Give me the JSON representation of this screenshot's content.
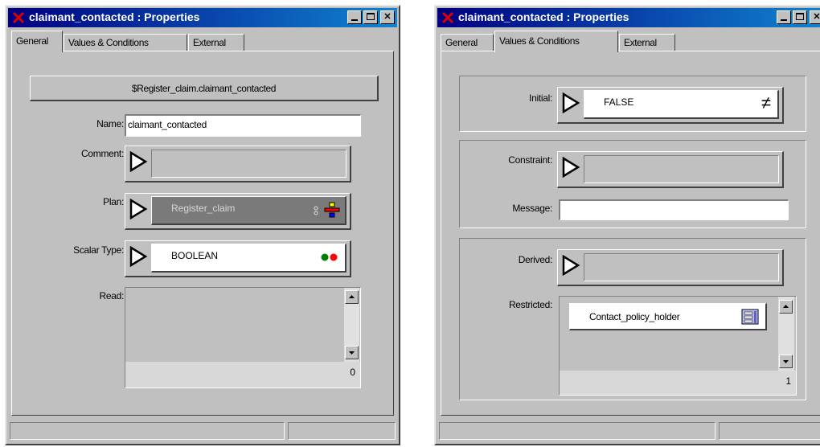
{
  "left_window": {
    "title": "claimant_contacted : Properties",
    "tabs": [
      "General",
      "Values & Conditions",
      "External"
    ],
    "active_tab": "General",
    "path_header": "$Register_claim.claimant_contacted",
    "name_label": "Name:",
    "name_value": "claimant_contacted",
    "comment_label": "Comment:",
    "plan_label": "Plan:",
    "plan_value": "Register_claim",
    "scalar_type_label": "Scalar Type:",
    "scalar_type_value": "BOOLEAN",
    "read_label": "Read:",
    "read_count": "0"
  },
  "right_window": {
    "title": "claimant_contacted : Properties",
    "tabs": [
      "General",
      "Values & Conditions",
      "External"
    ],
    "active_tab": "Values & Conditions",
    "initial_label": "Initial:",
    "initial_value": "FALSE",
    "constraint_label": "Constraint:",
    "message_label": "Message:",
    "message_value": "",
    "derived_label": "Derived:",
    "restricted_label": "Restricted:",
    "restricted_item": "Contact_policy_holder",
    "restricted_count": "1"
  },
  "icons": {
    "app": "app-x-icon",
    "slot_arrow": "pointer-arrow-icon",
    "not_equal": "not-equal-icon",
    "boolean_dots": "green-red-dots-icon"
  },
  "colors": {
    "titlebar_start": "#000080",
    "titlebar_end": "#1084d0",
    "window_face": "#c0c0c0",
    "plan_chip": "#7a7a7a",
    "dot_green": "#008000",
    "dot_red": "#ff0000"
  }
}
